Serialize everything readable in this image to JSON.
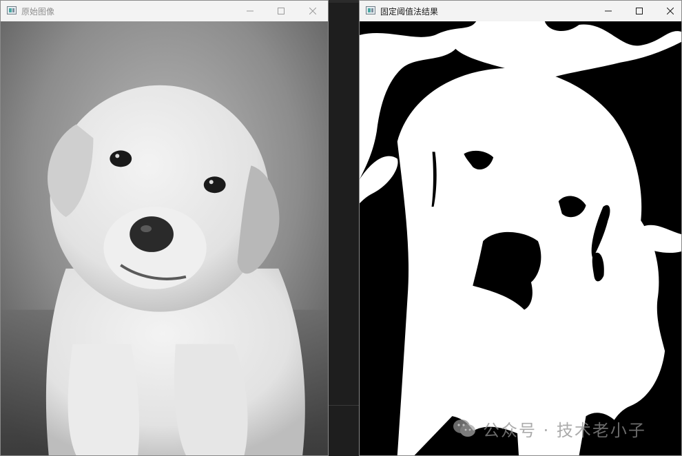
{
  "windows": {
    "original": {
      "title": "原始图像",
      "active": false,
      "image": {
        "subject": "grayscale puppy photo"
      },
      "controls": {
        "minimize": "minimize-icon",
        "maximize": "maximize-icon",
        "close": "close-icon"
      }
    },
    "threshold": {
      "title": "固定阈值法结果",
      "active": true,
      "image": {
        "subject": "binary threshold result of puppy"
      },
      "controls": {
        "minimize": "minimize-icon",
        "maximize": "maximize-icon",
        "close": "close-icon"
      }
    }
  },
  "watermark": {
    "text": "公众号 · 技术老小子",
    "icon": "wechat-icon"
  },
  "colors": {
    "titlebar": "#f3f3f3",
    "threshold_white": "#ffffff",
    "threshold_black": "#000000",
    "desktop": "#1c1c1c"
  }
}
